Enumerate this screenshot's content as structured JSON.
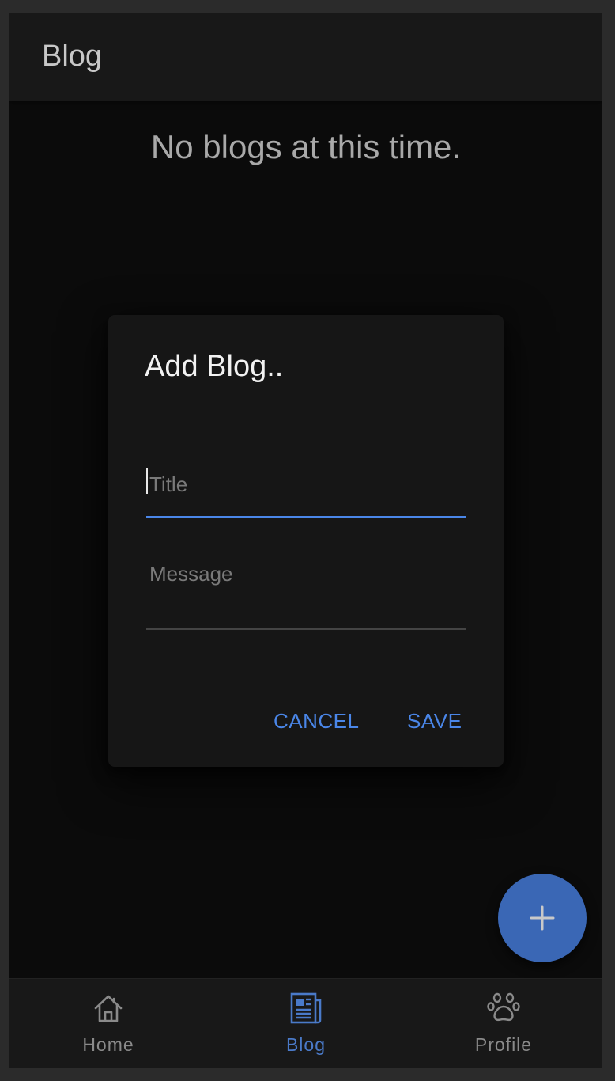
{
  "header": {
    "title": "Blog"
  },
  "main": {
    "empty_message": "No blogs at this time."
  },
  "dialog": {
    "title": "Add Blog..",
    "title_field": {
      "placeholder": "Title",
      "value": ""
    },
    "message_field": {
      "placeholder": "Message",
      "value": ""
    },
    "cancel_label": "CANCEL",
    "save_label": "SAVE"
  },
  "fab": {
    "icon": "plus-icon"
  },
  "tabs": [
    {
      "label": "Home",
      "icon": "home-icon",
      "active": false
    },
    {
      "label": "Blog",
      "icon": "newspaper-icon",
      "active": true
    },
    {
      "label": "Profile",
      "icon": "paw-icon",
      "active": false
    }
  ],
  "colors": {
    "accent": "#4a86e8",
    "fab": "#3a67b5",
    "background": "#0b0b0b",
    "surface": "#161616"
  }
}
